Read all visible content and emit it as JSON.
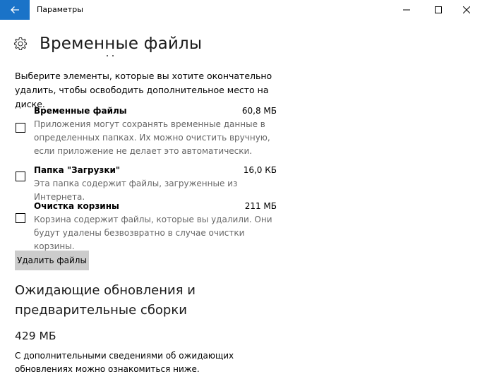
{
  "window": {
    "title": "Параметры",
    "back_icon": "arrow-left-icon",
    "accent_color": "#1a73c8",
    "controls": [
      "minimize-icon",
      "maximize-icon",
      "close-icon"
    ]
  },
  "page": {
    "icon": "gear-icon",
    "title": "Временные файлы",
    "intro": "Выберите элементы, которые вы хотите окончательно удалить, чтобы освободить дополнительное место на диске."
  },
  "items": [
    {
      "name": "Временные файлы",
      "size": "60,8 МБ",
      "description": "Приложения могут сохранять временные данные в определенных папках. Их можно очистить вручную, если приложение не делает это автоматически.",
      "checked": false
    },
    {
      "name": "Папка \"Загрузки\"",
      "size": "16,0 КБ",
      "description": "Эта папка содержит файлы, загруженные из Интернета.",
      "checked": false
    },
    {
      "name": "Очистка корзины",
      "size": "211 МБ",
      "description": "Корзина содержит файлы, которые вы удалили. Они будут удалены безвозвратно в случае очистки корзины.",
      "checked": false
    }
  ],
  "delete_button": "Удалить файлы",
  "pending": {
    "title": "Ожидающие обновления и предварительные сборки",
    "size": "429 МБ",
    "description": "С дополнительными сведениями об ожидающих обновлениях можно ознакомиться ниже."
  }
}
